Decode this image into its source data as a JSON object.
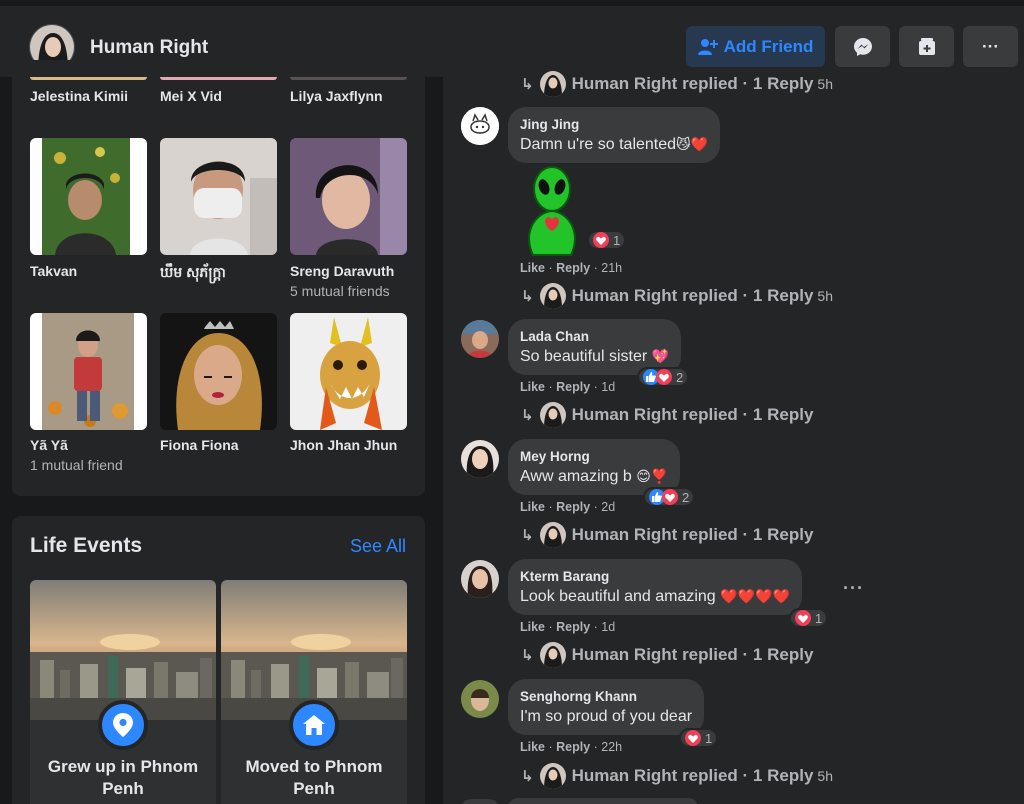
{
  "header": {
    "profile_name": "Human Right",
    "add_friend_label": "Add Friend"
  },
  "friends": [
    {
      "name": "Jelestina Kimii",
      "mutual": ""
    },
    {
      "name": "Mei X Vid",
      "mutual": ""
    },
    {
      "name": "Lilya Jaxflynn",
      "mutual": ""
    },
    {
      "name": "Takvan",
      "mutual": ""
    },
    {
      "name": "ឃឹម សុភ័ក្ត្រា",
      "mutual": ""
    },
    {
      "name": "Sreng Daravuth",
      "mutual": "5 mutual friends"
    },
    {
      "name": "Yã Yã",
      "mutual": "1 mutual friend"
    },
    {
      "name": "Fiona Fiona",
      "mutual": ""
    },
    {
      "name": "Jhon Jhan Jhun",
      "mutual": ""
    }
  ],
  "life_events": {
    "title": "Life Events",
    "see_all": "See All",
    "events": [
      {
        "label_line1": "Grew up in Phnom",
        "label_line2": "Penh",
        "icon": "location-pin-icon"
      },
      {
        "label_line1": "Moved to Phnom",
        "label_line2": "Penh",
        "icon": "home-icon"
      }
    ]
  },
  "comments": {
    "reply_prefix": "Human Right replied",
    "reply_suffix": "· 1 Reply",
    "like_label": "Like",
    "reply_label": "Reply",
    "replies": [
      {
        "time": "5h"
      },
      {
        "time": "5h"
      },
      {
        "time": ""
      },
      {
        "time": ""
      },
      {
        "time": ""
      },
      {
        "time": "5h"
      }
    ],
    "items": [
      {
        "author": "Jing Jing",
        "text": "Damn u're so talented",
        "emoji": "😼❤️",
        "time": "21h",
        "reactions": "1"
      },
      {
        "author": "Lada Chan",
        "text": "So beautiful sister",
        "emoji": "💖",
        "time": "1d",
        "reactions": "2"
      },
      {
        "author": "Mey Horng",
        "text": "Aww amazing b",
        "emoji": "😊❣️",
        "time": "2d",
        "reactions": "2"
      },
      {
        "author": "Kterm Barang",
        "text": "Look beautiful and amazing",
        "emoji": "❤️❤️❤️❤️",
        "time": "1d",
        "reactions": "1"
      },
      {
        "author": "Senghorng Khann",
        "text": "I'm so proud of you dear",
        "emoji": "",
        "time": "22h",
        "reactions": "1"
      }
    ]
  },
  "colors": {
    "accent": "#2d88ff",
    "surface": "#242526",
    "bubble": "#3a3b3c",
    "heart": "#f33e58"
  }
}
